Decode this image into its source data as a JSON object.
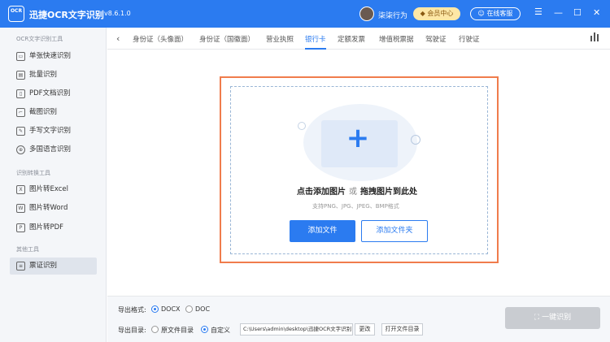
{
  "app": {
    "logo_text": "OCR",
    "title": "迅捷OCR文字识别",
    "version": "v8.6.1.0"
  },
  "header": {
    "username": "柒柒行为",
    "vip_label": "会员中心",
    "service_label": "在线客服",
    "menu_icon": "menu-icon",
    "minimize_icon": "minimize-icon",
    "maximize_icon": "maximize-icon",
    "close_icon": "close-icon"
  },
  "sidebar": {
    "groups": [
      {
        "title": "OCR文字识别工具",
        "items": [
          "单张快速识别",
          "批量识别",
          "PDF文档识别",
          "截图识别",
          "手写文字识别",
          "多国语言识别"
        ]
      },
      {
        "title": "识别转换工具",
        "items": [
          "图片转Excel",
          "图片转Word",
          "图片转PDF"
        ]
      },
      {
        "title": "其他工具",
        "items": [
          "票证识别"
        ]
      }
    ],
    "active_item": "票证识别"
  },
  "tabs": [
    "身份证（头像面）",
    "身份证（国徽面）",
    "营业执照",
    "银行卡",
    "定额发票",
    "增值税票据",
    "驾驶证",
    "行驶证"
  ],
  "active_tab": "银行卡",
  "upload": {
    "drop_text_a": "点击添加图片",
    "drop_or": "或",
    "drop_text_b": "拖拽图片到此处",
    "formats_hint": "支持PNG、JPG、JPEG、BMP格式",
    "add_file": "添加文件",
    "add_folder": "添加文件夹"
  },
  "bottom": {
    "format_label": "导出格式:",
    "format_options": [
      "DOCX",
      "DOC"
    ],
    "format_selected": "DOCX",
    "dir_label": "导出目录:",
    "dir_options": [
      "原文件目录",
      "自定义"
    ],
    "dir_selected": "自定义",
    "path_value": "C:\\Users\\admin\\desktop\\迅捷OCR文字识别",
    "change_label": "更改",
    "open_folder_label": "打开文件目录",
    "run_label": "一键识别"
  },
  "colors": {
    "primary": "#2b7bf0",
    "highlight_border": "#f07c4c",
    "disabled": "#c9ccd1"
  }
}
